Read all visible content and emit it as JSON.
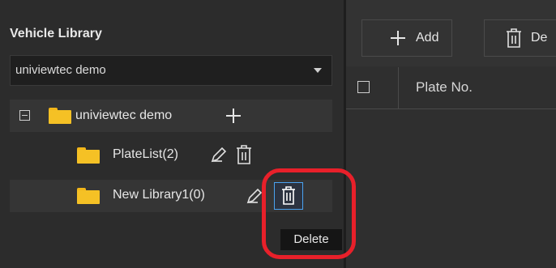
{
  "library_panel": {
    "title": "Vehicle Library",
    "selector_value": "univiewtec demo"
  },
  "tree": {
    "root_label": "univiewtec demo",
    "children": [
      {
        "label": "PlateList(2)"
      },
      {
        "label": "New Library1(0)"
      }
    ]
  },
  "tooltip": {
    "text": "Delete"
  },
  "toolbar": {
    "add_label": "Add",
    "delete_label_partial": "De"
  },
  "table": {
    "columns": [
      "Plate No."
    ]
  },
  "colors": {
    "highlight": "#e8202a",
    "selection": "#4aa3f0",
    "folder": "#f5c125"
  },
  "icons": {
    "collapse": "minus-square-icon",
    "folder": "folder-icon",
    "add": "plus-icon",
    "edit": "pencil-icon",
    "delete": "trash-icon",
    "dropdown": "caret-down-icon",
    "checkbox": "checkbox-icon"
  }
}
